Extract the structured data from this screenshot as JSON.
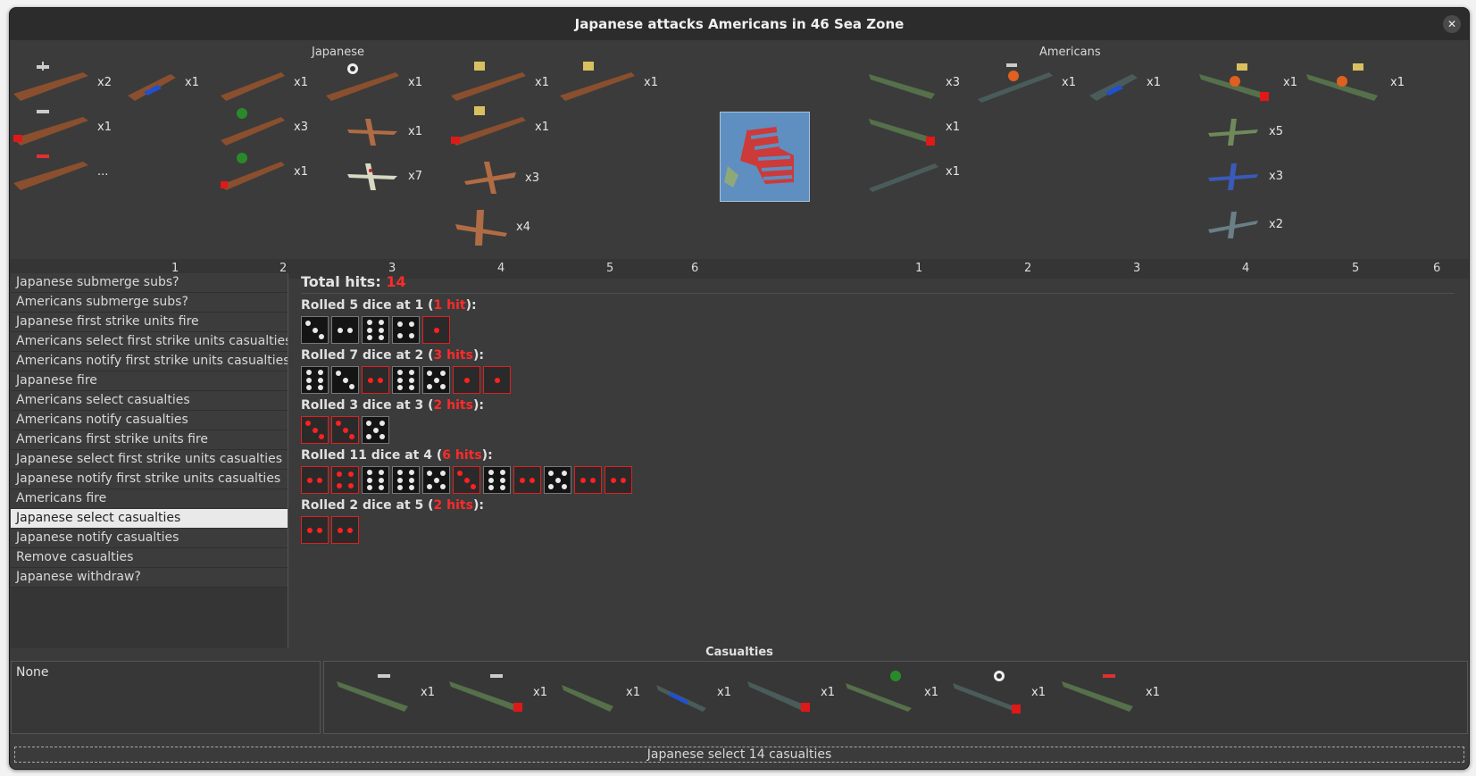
{
  "window": {
    "title": "Japanese attacks Americans in 46 Sea Zone",
    "close_icon": "close-icon"
  },
  "japanese": {
    "label": "Japanese",
    "columns": [
      "1",
      "2",
      "3",
      "4",
      "5",
      "6"
    ],
    "units": [
      {
        "name": "carrier",
        "count": "x2"
      },
      {
        "name": "submarine",
        "count": "x1"
      },
      {
        "name": "carrier-damaged",
        "count": "x1"
      },
      {
        "name": "carrier-red-marker",
        "count": "..."
      },
      {
        "name": "destroyer",
        "count": "x1"
      },
      {
        "name": "cruiser-green",
        "count": "x3"
      },
      {
        "name": "cruiser-green-damaged",
        "count": "x1"
      },
      {
        "name": "battleship-target",
        "count": "x1"
      },
      {
        "name": "fighter",
        "count": "x1"
      },
      {
        "name": "fighter-zero",
        "count": "x7"
      },
      {
        "name": "battleship",
        "count": "x1"
      },
      {
        "name": "battleship-damaged",
        "count": "x1"
      },
      {
        "name": "bomber",
        "count": "x3"
      },
      {
        "name": "heavy-bomber",
        "count": "x4"
      },
      {
        "name": "battleship-col5",
        "count": "x1"
      }
    ]
  },
  "americans": {
    "label": "Americans",
    "columns": [
      "1",
      "2",
      "3",
      "4",
      "5",
      "6"
    ],
    "units": [
      {
        "name": "transport",
        "count": "x3"
      },
      {
        "name": "transport-damaged",
        "count": "x1"
      },
      {
        "name": "transport-grey",
        "count": "x1"
      },
      {
        "name": "carrier-burning",
        "count": "x1"
      },
      {
        "name": "submarine",
        "count": "x1"
      },
      {
        "name": "battleship-burning-damaged",
        "count": "x1"
      },
      {
        "name": "fighter",
        "count": "x5"
      },
      {
        "name": "fighter-blue",
        "count": "x3"
      },
      {
        "name": "fighter-grey",
        "count": "x2"
      },
      {
        "name": "battleship-burning",
        "count": "x1"
      }
    ]
  },
  "steps": [
    "Japanese submerge subs?",
    "Americans submerge subs?",
    "Japanese first strike units fire",
    "Americans select first strike units casualties",
    "Americans notify first strike units casualties",
    "Japanese fire",
    "Americans select casualties",
    "Americans notify casualties",
    "Americans first strike units fire",
    "Japanese select first strike units casualties",
    "Japanese notify first strike units casualties",
    "Americans fire",
    "Japanese select casualties",
    "Japanese notify casualties",
    "Remove casualties",
    "Japanese withdraw?"
  ],
  "selected_step_index": 12,
  "results": {
    "total_label": "Total hits:",
    "total_value": "14",
    "rolls": [
      {
        "prefix": "Rolled 5 dice at 1 (",
        "hits": "1 hit",
        "suffix": "):",
        "dice": [
          {
            "v": 3,
            "hit": false
          },
          {
            "v": 2,
            "hit": false
          },
          {
            "v": 6,
            "hit": false
          },
          {
            "v": 4,
            "hit": false
          },
          {
            "v": 1,
            "hit": true
          }
        ]
      },
      {
        "prefix": "Rolled 7 dice at 2 (",
        "hits": "3 hits",
        "suffix": "):",
        "dice": [
          {
            "v": 6,
            "hit": false
          },
          {
            "v": 3,
            "hit": false
          },
          {
            "v": 2,
            "hit": true
          },
          {
            "v": 6,
            "hit": false
          },
          {
            "v": 5,
            "hit": false
          },
          {
            "v": 1,
            "hit": true
          },
          {
            "v": 1,
            "hit": true
          }
        ]
      },
      {
        "prefix": "Rolled 3 dice at 3 (",
        "hits": "2 hits",
        "suffix": "):",
        "dice": [
          {
            "v": 3,
            "hit": true
          },
          {
            "v": 3,
            "hit": true
          },
          {
            "v": 5,
            "hit": false
          }
        ]
      },
      {
        "prefix": "Rolled 11 dice at 4 (",
        "hits": "6 hits",
        "suffix": "):",
        "dice": [
          {
            "v": 2,
            "hit": true
          },
          {
            "v": 4,
            "hit": true
          },
          {
            "v": 6,
            "hit": false
          },
          {
            "v": 6,
            "hit": false
          },
          {
            "v": 5,
            "hit": false
          },
          {
            "v": 3,
            "hit": true
          },
          {
            "v": 6,
            "hit": false
          },
          {
            "v": 2,
            "hit": true
          },
          {
            "v": 5,
            "hit": false
          },
          {
            "v": 2,
            "hit": true
          },
          {
            "v": 2,
            "hit": true
          }
        ]
      },
      {
        "prefix": "Rolled 2 dice at 5 (",
        "hits": "2 hits",
        "suffix": "):",
        "dice": [
          {
            "v": 2,
            "hit": true
          },
          {
            "v": 2,
            "hit": true
          }
        ]
      }
    ]
  },
  "casualties": {
    "title": "Casualties",
    "none_label": "None",
    "units": [
      {
        "name": "carrier",
        "count": "x1"
      },
      {
        "name": "carrier-damaged",
        "count": "x1"
      },
      {
        "name": "transport",
        "count": "x1"
      },
      {
        "name": "transport-blue",
        "count": "x1"
      },
      {
        "name": "submarine-damaged",
        "count": "x1"
      },
      {
        "name": "cruiser-green",
        "count": "x1"
      },
      {
        "name": "battleship-target-damaged",
        "count": "x1"
      },
      {
        "name": "carrier-red-marker",
        "count": "x1"
      }
    ]
  },
  "status": "Japanese select 14 casualties",
  "colors": {
    "japanese_ship": "#8a4f2e",
    "american_ship": "#55704a",
    "hit_red": "#ff2a2a",
    "background": "#3b3b3b"
  }
}
